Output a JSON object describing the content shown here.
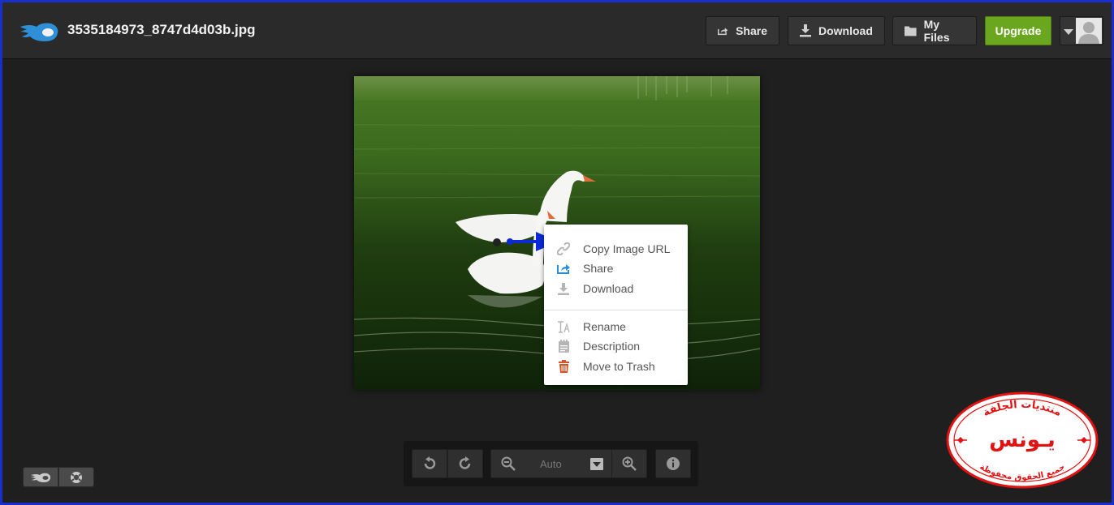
{
  "header": {
    "filename": "3535184973_8747d4d03b.jpg",
    "share_label": "Share",
    "download_label": "Download",
    "myfiles_label": "My Files",
    "upgrade_label": "Upgrade"
  },
  "icons": {
    "logo": "mediafire-flame-icon",
    "share": "share-icon",
    "download": "download-icon",
    "myfiles": "folder-icon",
    "user": "user-avatar-icon"
  },
  "context_menu": {
    "items": [
      {
        "label": "Copy Image URL",
        "icon": "link-icon"
      },
      {
        "label": "Share",
        "icon": "share-icon"
      },
      {
        "label": "Download",
        "icon": "download-icon"
      },
      {
        "label": "Rename",
        "icon": "rename-icon"
      },
      {
        "label": "Description",
        "icon": "notepad-icon"
      },
      {
        "label": "Move to Trash",
        "icon": "trash-icon"
      }
    ]
  },
  "zoom_toolbar": {
    "zoom_value": "Auto",
    "buttons": [
      "rotate-left-icon",
      "rotate-right-icon",
      "zoom-out-icon",
      "zoom-in-icon",
      "info-icon"
    ]
  },
  "colors": {
    "upgrade": "#6aa71f",
    "arrow": "#0a2bd6",
    "stamp": "#e31212",
    "share_icon_accent": "#2a8fd8",
    "trash_icon": "#d2552a"
  },
  "stamp": {
    "top_text": "منتديات الجلفة",
    "center_text": "يـونس",
    "bottom_text": "جميع الحقوق محفوظة"
  }
}
